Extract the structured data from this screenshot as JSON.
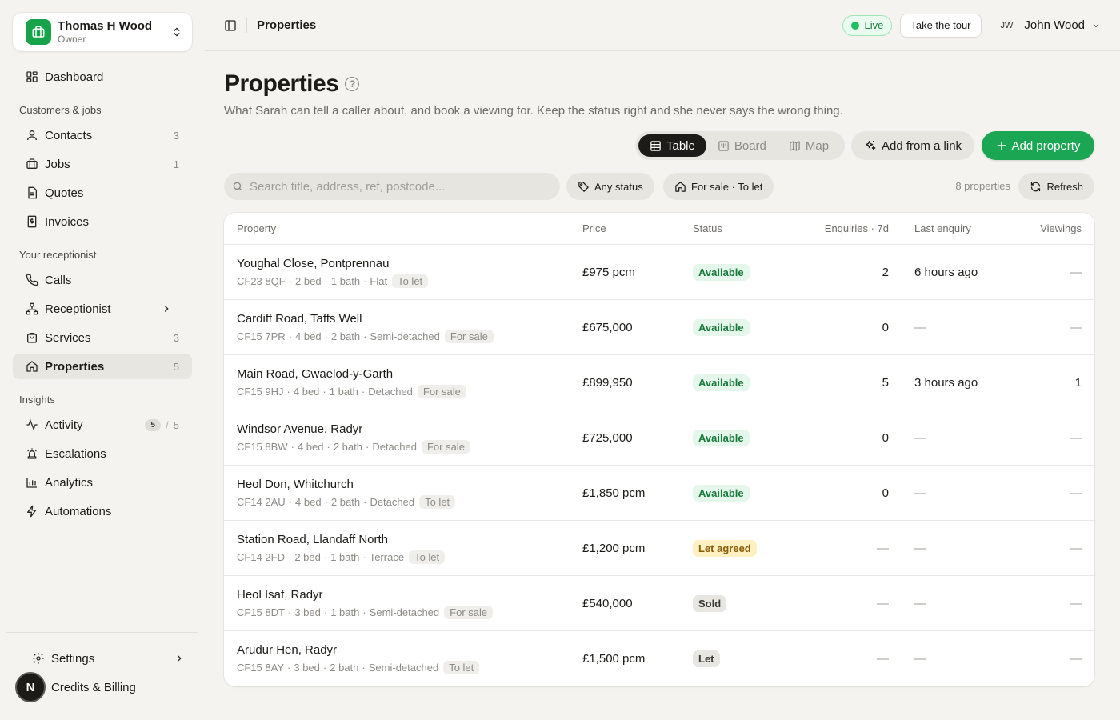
{
  "account": {
    "name": "Thomas H Wood",
    "role": "Owner"
  },
  "nav": {
    "dashboard": "Dashboard",
    "section_customers": "Customers & jobs",
    "contacts": {
      "label": "Contacts",
      "count": "3"
    },
    "jobs": {
      "label": "Jobs",
      "count": "1"
    },
    "quotes": "Quotes",
    "invoices": "Invoices",
    "section_receptionist": "Your receptionist",
    "calls": "Calls",
    "receptionist": "Receptionist",
    "services": {
      "label": "Services",
      "count": "3"
    },
    "properties": {
      "label": "Properties",
      "count": "5"
    },
    "section_insights": "Insights",
    "activity": {
      "label": "Activity",
      "badge": "5",
      "slash": "/",
      "count": "5"
    },
    "escalations": "Escalations",
    "analytics": "Analytics",
    "automations": "Automations",
    "settings": "Settings",
    "billing": "Credits & Billing",
    "avatar_letter": "N"
  },
  "topbar": {
    "breadcrumb": "Properties",
    "live": "Live",
    "tour": "Take the tour",
    "user_initials": "JW",
    "user_name": "John Wood"
  },
  "page": {
    "title": "Properties",
    "help": "?",
    "subtitle": "What Sarah can tell a caller about, and book a viewing for. Keep the status right and she never says the wrong thing.",
    "views": {
      "table": "Table",
      "board": "Board",
      "map": "Map",
      "active": "Table"
    },
    "add_link": "Add from a link",
    "add_property": "Add property",
    "search_placeholder": "Search title, address, ref, postcode...",
    "status_filter": "Any status",
    "type_filter": "For sale · To let",
    "count_text": "8 properties",
    "refresh": "Refresh"
  },
  "table": {
    "columns": [
      "Property",
      "Price",
      "Status",
      "Enquiries · 7d",
      "Last enquiry",
      "Viewings"
    ],
    "rows": [
      {
        "title": "Youghal Close, Pontprennau",
        "postcode": "CF23 8QF",
        "beds": "2 bed",
        "baths": "1 bath",
        "type": "Flat",
        "tag": "To let",
        "price": "£975 pcm",
        "status": "Available",
        "enquiries": "2",
        "last": "6 hours ago",
        "viewings": "—"
      },
      {
        "title": "Cardiff Road, Taffs Well",
        "postcode": "CF15 7PR",
        "beds": "4 bed",
        "baths": "2 bath",
        "type": "Semi-detached",
        "tag": "For sale",
        "price": "£675,000",
        "status": "Available",
        "enquiries": "0",
        "last": "—",
        "viewings": "—"
      },
      {
        "title": "Main Road, Gwaelod-y-Garth",
        "postcode": "CF15 9HJ",
        "beds": "4 bed",
        "baths": "1 bath",
        "type": "Detached",
        "tag": "For sale",
        "price": "£899,950",
        "status": "Available",
        "enquiries": "5",
        "last": "3 hours ago",
        "viewings": "1"
      },
      {
        "title": "Windsor Avenue, Radyr",
        "postcode": "CF15 8BW",
        "beds": "4 bed",
        "baths": "2 bath",
        "type": "Detached",
        "tag": "For sale",
        "price": "£725,000",
        "status": "Available",
        "enquiries": "0",
        "last": "—",
        "viewings": "—"
      },
      {
        "title": "Heol Don, Whitchurch",
        "postcode": "CF14 2AU",
        "beds": "4 bed",
        "baths": "2 bath",
        "type": "Detached",
        "tag": "To let",
        "price": "£1,850 pcm",
        "status": "Available",
        "enquiries": "0",
        "last": "—",
        "viewings": "—"
      },
      {
        "title": "Station Road, Llandaff North",
        "postcode": "CF14 2FD",
        "beds": "2 bed",
        "baths": "1 bath",
        "type": "Terrace",
        "tag": "To let",
        "price": "£1,200 pcm",
        "status": "Let agreed",
        "enquiries": "—",
        "last": "—",
        "viewings": "—"
      },
      {
        "title": "Heol Isaf, Radyr",
        "postcode": "CF15 8DT",
        "beds": "3 bed",
        "baths": "1 bath",
        "type": "Semi-detached",
        "tag": "For sale",
        "price": "£540,000",
        "status": "Sold",
        "enquiries": "—",
        "last": "—",
        "viewings": "—"
      },
      {
        "title": "Arudur Hen, Radyr",
        "postcode": "CF15 8AY",
        "beds": "3 bed",
        "baths": "2 bath",
        "type": "Semi-detached",
        "tag": "To let",
        "price": "£1,500 pcm",
        "status": "Let",
        "enquiries": "—",
        "last": "—",
        "viewings": "—"
      }
    ]
  },
  "colors": {
    "accent": "#1aa653",
    "available": "#e5f7ea",
    "let_agreed": "#fdf0c2",
    "neutral": "#e8e6e1",
    "background": "#f4f3ef"
  }
}
